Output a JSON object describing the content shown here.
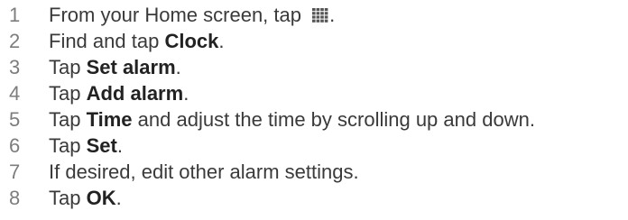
{
  "steps": [
    {
      "number": "1",
      "parts": [
        {
          "text": "From your Home screen, tap "
        },
        {
          "icon": "app-grid-icon"
        },
        {
          "text": "."
        }
      ]
    },
    {
      "number": "2",
      "parts": [
        {
          "text": "Find and tap "
        },
        {
          "text": "Clock",
          "bold": true
        },
        {
          "text": "."
        }
      ]
    },
    {
      "number": "3",
      "parts": [
        {
          "text": "Tap "
        },
        {
          "text": "Set alarm",
          "bold": true
        },
        {
          "text": "."
        }
      ]
    },
    {
      "number": "4",
      "parts": [
        {
          "text": "Tap "
        },
        {
          "text": "Add alarm",
          "bold": true
        },
        {
          "text": "."
        }
      ]
    },
    {
      "number": "5",
      "parts": [
        {
          "text": "Tap "
        },
        {
          "text": "Time",
          "bold": true
        },
        {
          "text": " and adjust the time by scrolling up and down."
        }
      ]
    },
    {
      "number": "6",
      "parts": [
        {
          "text": "Tap "
        },
        {
          "text": "Set",
          "bold": true
        },
        {
          "text": "."
        }
      ]
    },
    {
      "number": "7",
      "parts": [
        {
          "text": "If desired, edit other alarm settings."
        }
      ]
    },
    {
      "number": "8",
      "parts": [
        {
          "text": "Tap "
        },
        {
          "text": "OK",
          "bold": true
        },
        {
          "text": "."
        }
      ]
    }
  ],
  "colors": {
    "text": "#3a3a3a",
    "number": "#7d7d7d",
    "icon": "#555555"
  }
}
